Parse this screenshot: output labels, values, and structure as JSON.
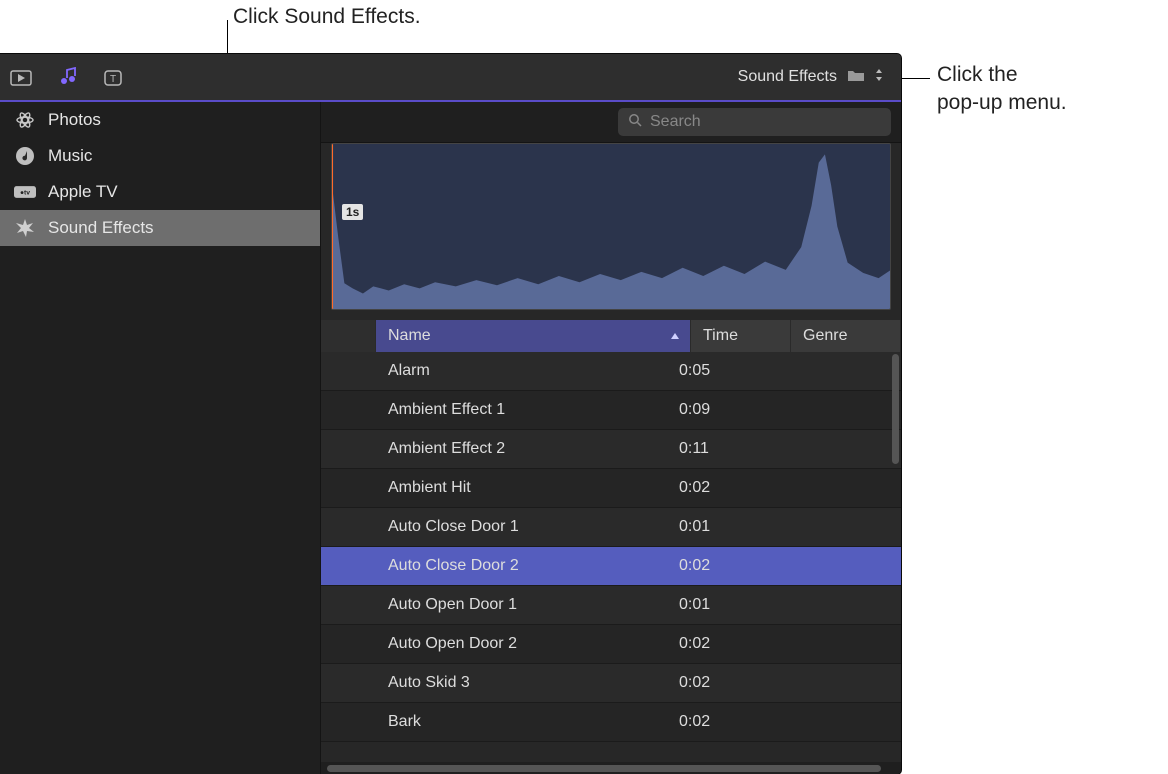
{
  "callouts": {
    "top": "Click Sound Effects.",
    "right_line1": "Click the",
    "right_line2": "pop-up menu."
  },
  "popup_label": "Sound Effects",
  "search_placeholder": "Search",
  "preview_marker": "1s",
  "sidebar": {
    "items": [
      {
        "label": "Photos",
        "icon": "photos"
      },
      {
        "label": "Music",
        "icon": "music"
      },
      {
        "label": "Apple TV",
        "icon": "appletv"
      },
      {
        "label": "Sound Effects",
        "icon": "burst",
        "selected": true
      }
    ]
  },
  "columns": {
    "name": "Name",
    "time": "Time",
    "genre": "Genre"
  },
  "rows": [
    {
      "name": "Alarm",
      "time": "0:05"
    },
    {
      "name": "Ambient Effect 1",
      "time": "0:09"
    },
    {
      "name": "Ambient Effect 2",
      "time": "0:11"
    },
    {
      "name": "Ambient Hit",
      "time": "0:02"
    },
    {
      "name": "Auto Close Door 1",
      "time": "0:01"
    },
    {
      "name": "Auto Close Door 2",
      "time": "0:02",
      "selected": true
    },
    {
      "name": "Auto Open Door 1",
      "time": "0:01"
    },
    {
      "name": "Auto Open Door 2",
      "time": "0:02"
    },
    {
      "name": "Auto Skid 3",
      "time": "0:02"
    },
    {
      "name": "Bark",
      "time": "0:02"
    }
  ]
}
